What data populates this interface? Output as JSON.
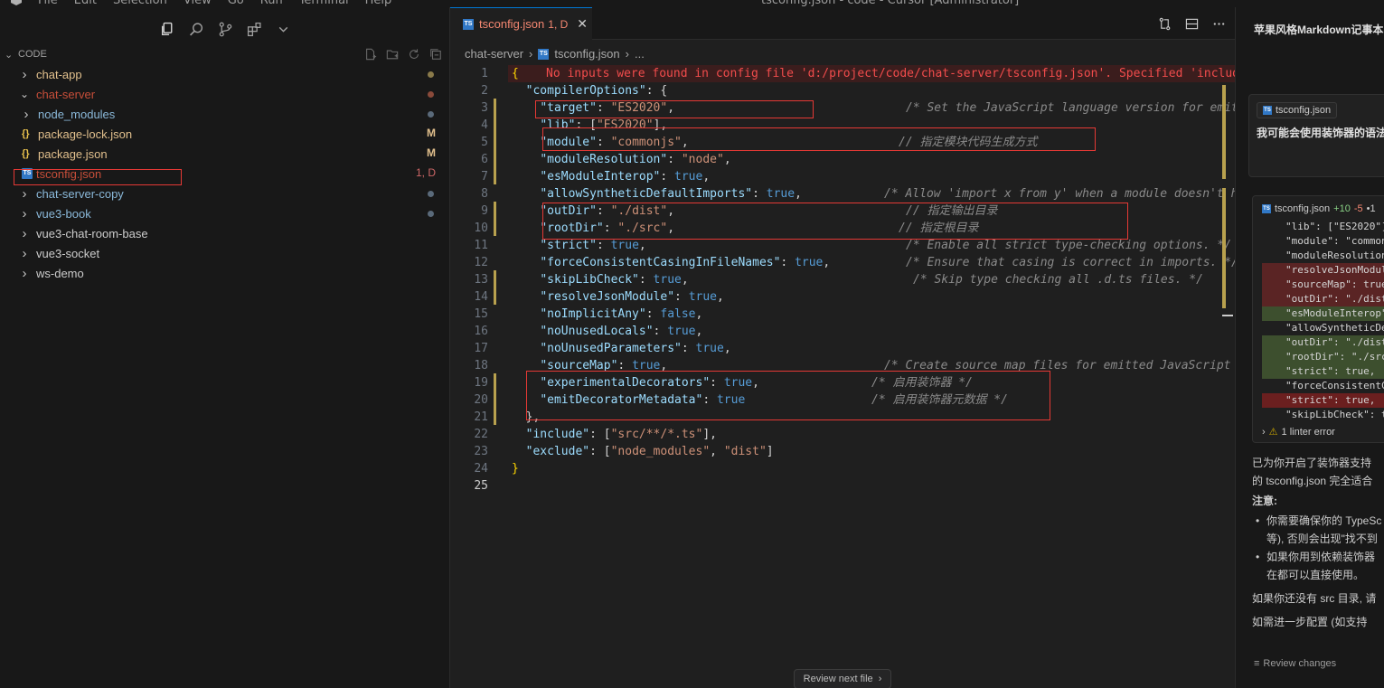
{
  "window": {
    "title": "tsconfig.json - code - Cursor [Administrator]",
    "menu": [
      "File",
      "Edit",
      "Selection",
      "View",
      "Go",
      "Run",
      "Terminal",
      "Help"
    ]
  },
  "sidebar": {
    "section_label": "CODE",
    "tree": [
      {
        "label": "chat-app",
        "depth": 0,
        "type": "folder",
        "open": false,
        "color": "yellow",
        "dot": "#8a7a4a"
      },
      {
        "label": "chat-server",
        "depth": 0,
        "type": "folder",
        "open": true,
        "color": "red",
        "dot": "#8a4a3a"
      },
      {
        "label": "node_modules",
        "depth": 1,
        "type": "folder",
        "open": false,
        "color": "blue",
        "dot": "#5a6a7a"
      },
      {
        "label": "package-lock.json",
        "depth": 1,
        "type": "json",
        "color": "yellow",
        "badge": "M"
      },
      {
        "label": "package.json",
        "depth": 1,
        "type": "json",
        "color": "yellow",
        "badge": "M"
      },
      {
        "label": "tsconfig.json",
        "depth": 1,
        "type": "ts",
        "color": "red",
        "badge": "1, D"
      },
      {
        "label": "chat-server-copy",
        "depth": 0,
        "type": "folder",
        "open": false,
        "color": "blue",
        "dot": "#5a6a7a"
      },
      {
        "label": "vue3-book",
        "depth": 0,
        "type": "folder",
        "open": false,
        "color": "blue",
        "dot": "#5a6a7a"
      },
      {
        "label": "vue3-chat-room-base",
        "depth": 0,
        "type": "folder",
        "open": false,
        "color": "plain"
      },
      {
        "label": "vue3-socket",
        "depth": 0,
        "type": "folder",
        "open": false,
        "color": "plain"
      },
      {
        "label": "ws-demo",
        "depth": 0,
        "type": "folder",
        "open": false,
        "color": "plain"
      }
    ]
  },
  "editor": {
    "tab": {
      "name": "tsconfig.json",
      "severity": "1, D",
      "file_icon": "TS"
    },
    "breadcrumb": [
      "chat-server",
      "tsconfig.json",
      "..."
    ],
    "error_message": "No inputs were found in config file 'd:/project/code/chat-server/tsconfig.json'. Specified 'include'",
    "lines": [
      {
        "n": "1",
        "t": "{"
      },
      {
        "n": "2",
        "t": "  \"compilerOptions\": {"
      },
      {
        "n": "3",
        "t": "    \"target\": \"ES2020\",",
        "c": "/* Set the JavaScript language version for emit"
      },
      {
        "n": "4",
        "t": "    \"lib\": [\"ES2020\"],"
      },
      {
        "n": "5",
        "t": "    \"module\": \"commonjs\",",
        "c": "// 指定模块代码生成方式"
      },
      {
        "n": "6",
        "t": "    \"moduleResolution\": \"node\","
      },
      {
        "n": "7",
        "t": "    \"esModuleInterop\": true,"
      },
      {
        "n": "8",
        "t": "    \"allowSyntheticDefaultImports\": true,",
        "c": "/* Allow 'import x from y' when a module doesn't h"
      },
      {
        "n": "9",
        "t": "    \"outDir\": \"./dist\",",
        "c": "// 指定输出目录"
      },
      {
        "n": "10",
        "t": "    \"rootDir\": \"./src\",",
        "c": "// 指定根目录"
      },
      {
        "n": "11",
        "t": "    \"strict\": true,",
        "c": "/* Enable all strict type-checking options. */"
      },
      {
        "n": "12",
        "t": "    \"forceConsistentCasingInFileNames\": true,",
        "c": "/* Ensure that casing is correct in imports. */"
      },
      {
        "n": "13",
        "t": "    \"skipLibCheck\": true,",
        "c": "/* Skip type checking all .d.ts files. */"
      },
      {
        "n": "14",
        "t": "    \"resolveJsonModule\": true,"
      },
      {
        "n": "15",
        "t": "    \"noImplicitAny\": false,"
      },
      {
        "n": "16",
        "t": "    \"noUnusedLocals\": true,"
      },
      {
        "n": "17",
        "t": "    \"noUnusedParameters\": true,"
      },
      {
        "n": "18",
        "t": "    \"sourceMap\": true,",
        "c": "/* Create source map files for emitted JavaScript"
      },
      {
        "n": "19",
        "t": "    \"experimentalDecorators\": true,",
        "c": "/* 启用装饰器 */"
      },
      {
        "n": "20",
        "t": "    \"emitDecoratorMetadata\": true",
        "c": "/* 启用装饰器元数据 */"
      },
      {
        "n": "21",
        "t": "  },"
      },
      {
        "n": "22",
        "t": "  \"include\": [\"src/**/*.ts\"],"
      },
      {
        "n": "23",
        "t": "  \"exclude\": [\"node_modules\", \"dist\"]"
      },
      {
        "n": "24",
        "t": "}"
      },
      {
        "n": "25",
        "t": ""
      }
    ],
    "review_next_label": "Review next file"
  },
  "chat": {
    "title": "苹果风格Markdown记事本系统",
    "context_chip": "tsconfig.json",
    "question": "我可能会使用装饰器的语法",
    "diff": {
      "file": "tsconfig.json",
      "added": "+10",
      "removed": "-5",
      "extra": "•1",
      "lines": [
        {
          "t": "\"lib\": [\"ES2020\"],",
          "s": ""
        },
        {
          "t": "\"module\": \"commonjs\",",
          "s": ""
        },
        {
          "t": "\"moduleResolution\"",
          "s": ""
        },
        {
          "t": "\"resolveJsonModule\"",
          "s": "rm"
        },
        {
          "t": "\"sourceMap\": true,",
          "s": "rm"
        },
        {
          "t": "\"outDir\": \"./dist\"",
          "s": "rm"
        },
        {
          "t": "\"esModuleInterop\"",
          "s": "ad"
        },
        {
          "t": "\"allowSyntheticDef\"",
          "s": ""
        },
        {
          "t": "\"outDir\": \"./dist\"",
          "s": "ad"
        },
        {
          "t": "\"rootDir\": \"./src\"",
          "s": "ad"
        },
        {
          "t": "\"strict\": true,",
          "s": "ad"
        },
        {
          "t": "\"forceConsistentC\"",
          "s": ""
        },
        {
          "t": "\"strict\": true,",
          "s": "rm2"
        },
        {
          "t": "\"skipLibCheck\": t",
          "s": ""
        }
      ],
      "linter": "1 linter error"
    },
    "body": {
      "p1a": "已为你开启了装饰器支持",
      "p1b": "的 tsconfig.json 完全适合",
      "note": "注意:",
      "li1a": "你需要确保你的 TypeSc",
      "li1b": "等), 否则会出现\"找不到",
      "li2a": "如果你用到依赖装饰器",
      "li2b": "在都可以直接使用。",
      "p2": "如果你还没有 src 目录, 请",
      "p3": "如需进一步配置 (如支持"
    },
    "review_changes_label": "Review changes"
  }
}
